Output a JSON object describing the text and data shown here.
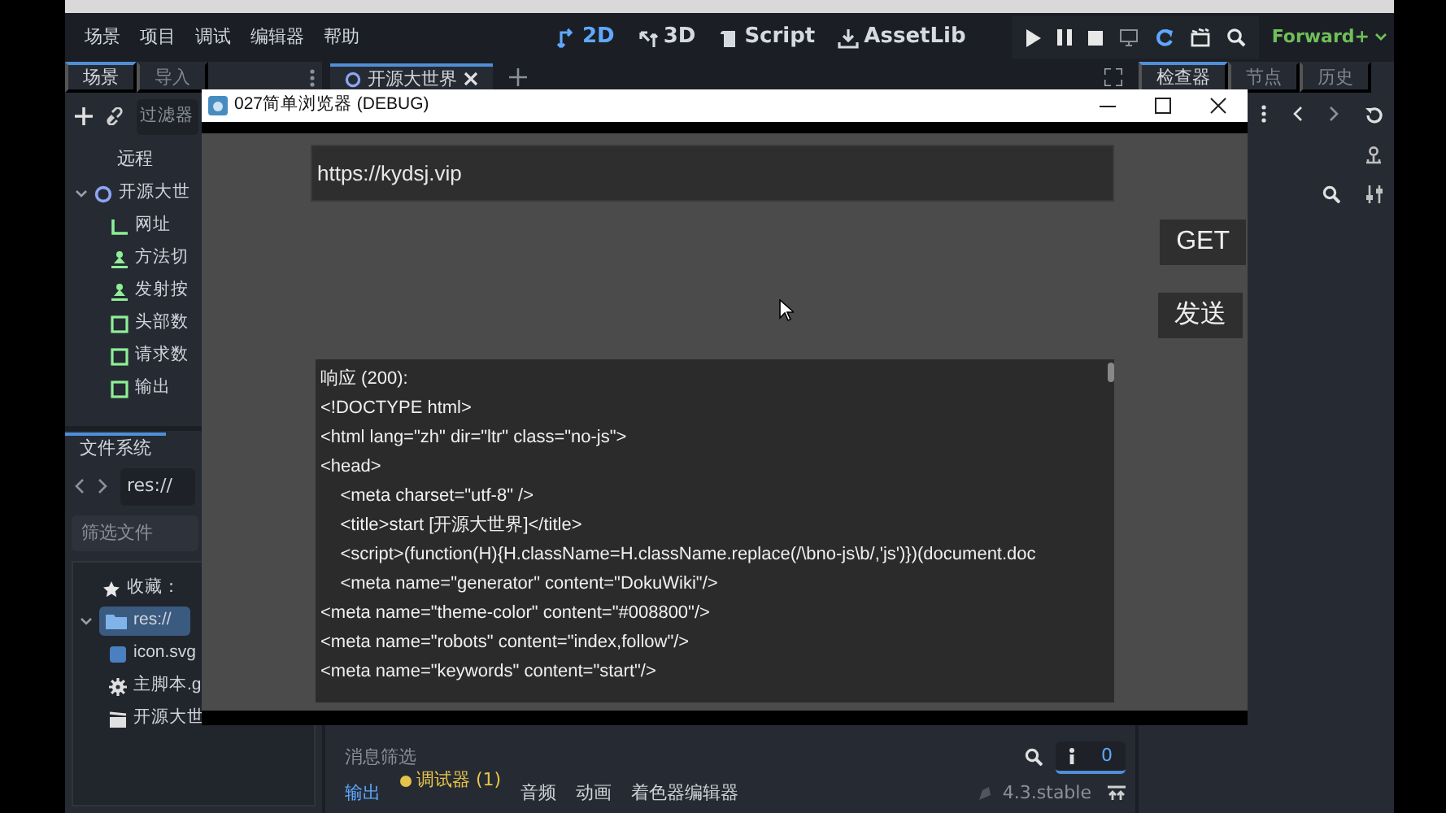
{
  "menu": [
    "场景",
    "项目",
    "调试",
    "编辑器",
    "帮助"
  ],
  "workspaces": [
    {
      "label": "2D",
      "selected": true
    },
    {
      "label": "3D",
      "selected": false
    },
    {
      "label": "Script",
      "selected": false
    },
    {
      "label": "AssetLib",
      "selected": false
    }
  ],
  "renderer": "Forward+",
  "scene_dock": {
    "tabs": [
      {
        "label": "场景",
        "selected": true
      },
      {
        "label": "导入",
        "selected": false
      }
    ],
    "filter_placeholder": "过滤器",
    "remote_label": "远程",
    "tree": [
      {
        "label": "开源大世",
        "kind": "node",
        "expanded": true,
        "children": [
          {
            "label": "网址",
            "kind": "line"
          },
          {
            "label": "方法切",
            "kind": "button"
          },
          {
            "label": "发射按",
            "kind": "button"
          },
          {
            "label": "头部数",
            "kind": "text"
          },
          {
            "label": "请求数",
            "kind": "text"
          },
          {
            "label": "输出",
            "kind": "text"
          }
        ]
      }
    ]
  },
  "filesystem": {
    "tab": "文件系统",
    "path": "res://",
    "filter_placeholder": "筛选文件",
    "favorites": "收藏：",
    "tree": [
      {
        "label": "res://",
        "selected": true,
        "expanded": true,
        "children": [
          {
            "label": "icon.svg",
            "kind": "image"
          },
          {
            "label": "主脚本.g",
            "kind": "script"
          },
          {
            "label": "开源大世",
            "kind": "scene"
          }
        ]
      }
    ]
  },
  "editor_tabs": [
    {
      "label": "开源大世界",
      "selected": true
    }
  ],
  "inspector": {
    "tabs": [
      {
        "label": "检查器",
        "selected": true
      },
      {
        "label": "节点",
        "selected": false
      },
      {
        "label": "历史",
        "selected": false
      }
    ]
  },
  "bottom_panel": {
    "filter_placeholder": "消息筛选",
    "info_filter_on": true,
    "message_count": "0",
    "tabs": [
      {
        "label": "输出",
        "selected": true,
        "alert": false
      },
      {
        "label": "调试器 (1)",
        "selected": false,
        "alert": true
      },
      {
        "label": "音频",
        "selected": false,
        "alert": false
      },
      {
        "label": "动画",
        "selected": false,
        "alert": false
      },
      {
        "label": "着色器编辑器",
        "selected": false,
        "alert": false
      }
    ],
    "version": "4.3.stable"
  },
  "debug_window": {
    "title": "027简单浏览器 (DEBUG)",
    "url": "https://kydsj.vip",
    "buttons": [
      "GET",
      "发送"
    ],
    "response": [
      "响应 (200):",
      "<!DOCTYPE html>",
      "<html lang=\"zh\" dir=\"ltr\" class=\"no-js\">",
      "<head>",
      "    <meta charset=\"utf-8\" />",
      "    <title>start [开源大世界]</title>",
      "    <script>(function(H){H.className=H.className.replace(/\\bno-js\\b/,'js')})(document.doc",
      "    <meta name=\"generator\" content=\"DokuWiki\"/>",
      "<meta name=\"theme-color\" content=\"#008800\"/>",
      "<meta name=\"robots\" content=\"index,follow\"/>",
      "<meta name=\"keywords\" content=\"start\"/>"
    ]
  }
}
